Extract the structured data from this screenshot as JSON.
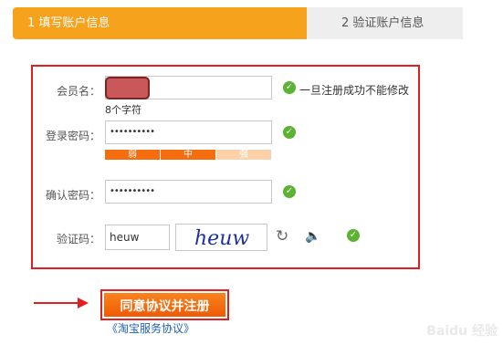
{
  "steps": {
    "step1": "1 填写账户信息",
    "step2": "2 验证账户信息"
  },
  "form": {
    "username": {
      "label": "会员名：",
      "note": "一旦注册成功不能修改",
      "sub_hint": "8个字符"
    },
    "password": {
      "label": "登录密码：",
      "value": "••••••••••",
      "strength": [
        "弱",
        "中",
        "强"
      ],
      "strength_level": 2
    },
    "confirm": {
      "label": "确认密码：",
      "value": "••••••••••"
    },
    "captcha": {
      "label": "验证码：",
      "value": "heuw",
      "image_text": "heuw"
    }
  },
  "submit_label": "同意协议并注册",
  "agreement_link": "《淘宝服务协议》",
  "icons": {
    "valid": "check-circle-icon",
    "refresh": "refresh-icon",
    "audio": "speaker-icon"
  },
  "watermark": "Baidu 经验",
  "colors": {
    "accent": "#f7a21c",
    "highlight": "#e02020",
    "ok": "#5bb233"
  }
}
